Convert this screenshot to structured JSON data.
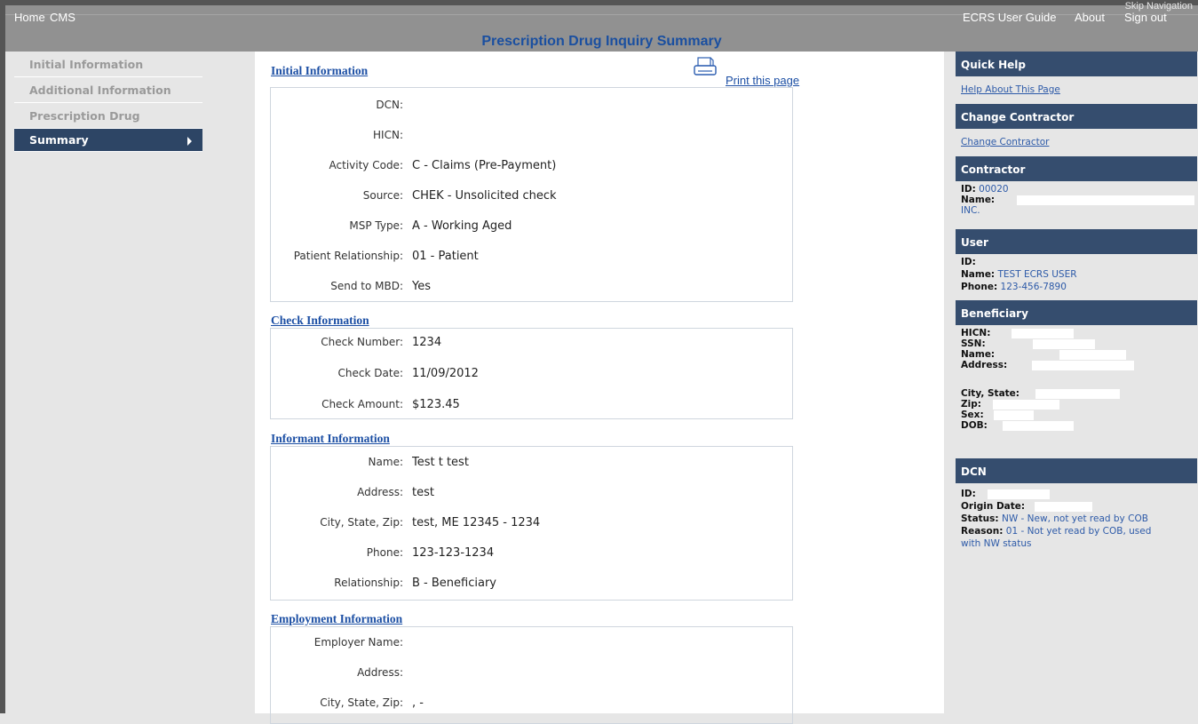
{
  "header": {
    "nav_left": [
      "Home",
      "CMS"
    ],
    "nav_right": [
      "ECRS User Guide",
      "About",
      "Sign out"
    ],
    "skip_nav": "Skip Navigation",
    "page_title": "Prescription Drug Inquiry Summary"
  },
  "leftnav": {
    "items": [
      {
        "label": "Initial Information"
      },
      {
        "label": "Additional Information"
      },
      {
        "label": "Prescription Drug"
      },
      {
        "label": "Summary"
      }
    ]
  },
  "main": {
    "print_label": "Print this page",
    "initial": {
      "title": "Initial Information",
      "rows": [
        {
          "label": "DCN:",
          "value": ""
        },
        {
          "label": "HICN:",
          "value": ""
        },
        {
          "label": "Activity Code:",
          "value": "C - Claims (Pre-Payment)"
        },
        {
          "label": "Source:",
          "value": "CHEK - Unsolicited check"
        },
        {
          "label": "MSP Type:",
          "value": "A - Working Aged"
        },
        {
          "label": "Patient Relationship:",
          "value": "01 - Patient"
        },
        {
          "label": "Send to MBD:",
          "value": "Yes"
        }
      ]
    },
    "check": {
      "title": "Check Information",
      "rows": [
        {
          "label": "Check Number:",
          "value": "1234"
        },
        {
          "label": "Check Date:",
          "value": "11/09/2012"
        },
        {
          "label": "Check Amount:",
          "value": "$123.45"
        }
      ]
    },
    "informant": {
      "title": "Informant Information",
      "rows": [
        {
          "label": "Name:",
          "value": "Test t test"
        },
        {
          "label": "Address:",
          "value": "test"
        },
        {
          "label": "City, State, Zip:",
          "value": "test, ME 12345 - 1234"
        },
        {
          "label": "Phone:",
          "value": "123-123-1234"
        },
        {
          "label": "Relationship:",
          "value": "B - Beneficiary"
        }
      ]
    },
    "employment": {
      "title": "Employment Information",
      "rows": [
        {
          "label": "Employer Name:",
          "value": ""
        },
        {
          "label": "Address:",
          "value": ""
        },
        {
          "label": "City, State, Zip:",
          "value": ", -"
        }
      ]
    }
  },
  "right": {
    "quick_help": {
      "title": "Quick Help",
      "link": "Help About This Page"
    },
    "change_contractor": {
      "title": "Change Contractor",
      "link": "Change Contractor"
    },
    "contractor": {
      "title": "Contractor",
      "id_label": "ID:",
      "id_value": "00020",
      "name_label": "Name:",
      "name_suffix": "INC."
    },
    "user": {
      "title": "User",
      "id_label": "ID:",
      "name_label": "Name:",
      "name_value": "TEST ECRS USER",
      "phone_label": "Phone:",
      "phone_value": "123-456-7890"
    },
    "beneficiary": {
      "title": "Beneficiary",
      "hicn_label": "HICN:",
      "ssn_label": "SSN:",
      "name_label": "Name:",
      "address_label": "Address:",
      "city_label": "City, State:",
      "zip_label": "Zip:",
      "sex_label": "Sex:",
      "dob_label": "DOB:"
    },
    "dcn": {
      "title": "DCN",
      "id_label": "ID:",
      "origin_label": "Origin Date:",
      "status_label": "Status:",
      "status_value": "NW - New, not yet read by COB",
      "reason_label": "Reason:",
      "reason_value": "01 - Not yet read by COB, used",
      "reason_value2": "with NW status"
    }
  }
}
